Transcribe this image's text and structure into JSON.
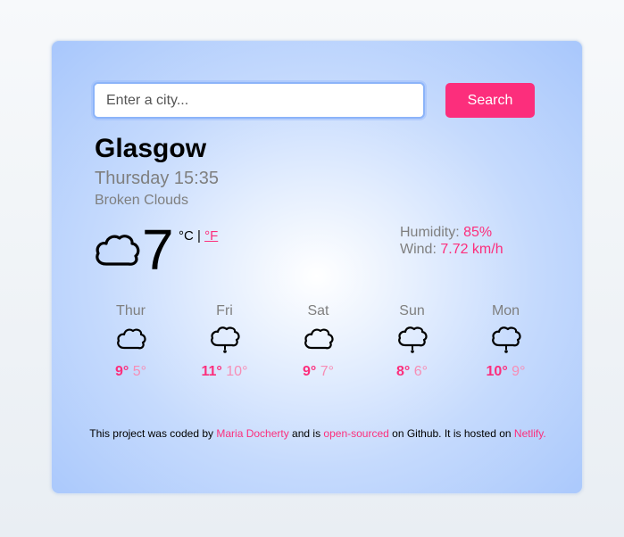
{
  "search": {
    "placeholder": "Enter a city...",
    "button_label": "Search"
  },
  "current": {
    "city": "Glasgow",
    "datetime": "Thursday 15:35",
    "description": "Broken Clouds",
    "icon": "cloud-icon",
    "temperature": "7",
    "unit_celsius": "°C",
    "unit_separator": " | ",
    "unit_fahrenheit": "°F",
    "humidity_label": "Humidity: ",
    "humidity_value": "85%",
    "wind_label": "Wind: ",
    "wind_value": "7.72 km/h"
  },
  "forecast": [
    {
      "day": "Thur",
      "icon": "cloud-icon",
      "max": "9°",
      "min": "5°"
    },
    {
      "day": "Fri",
      "icon": "cloud-rain-icon",
      "max": "11°",
      "min": "10°"
    },
    {
      "day": "Sat",
      "icon": "cloud-icon",
      "max": "9°",
      "min": "7°"
    },
    {
      "day": "Sun",
      "icon": "cloud-rain-icon",
      "max": "8°",
      "min": "6°"
    },
    {
      "day": "Mon",
      "icon": "cloud-rain-icon",
      "max": "10°",
      "min": "9°"
    }
  ],
  "footer": {
    "text1": "This project was coded by ",
    "author": "Maria Docherty",
    "text2": " and is ",
    "open_source": "open-sourced",
    "text3": " on Github. It is hosted on ",
    "host": "Netlify."
  },
  "colors": {
    "accent": "#fc2e7c",
    "accent_light": "#f78db5",
    "muted_text": "#7f7f7f",
    "card_edge": "#a8c7fc"
  }
}
